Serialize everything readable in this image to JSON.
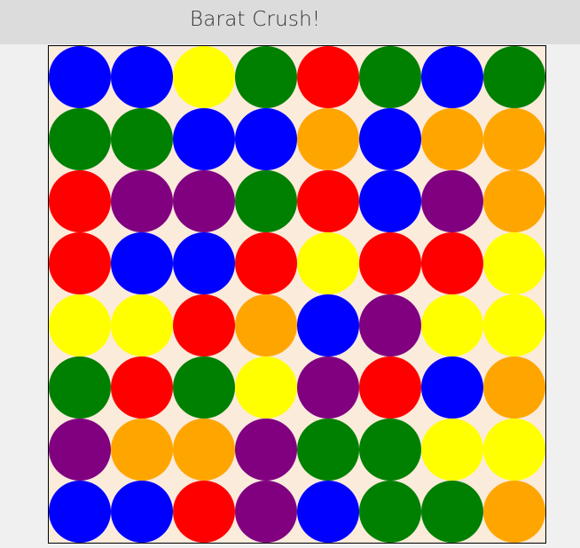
{
  "header": {
    "title": "Barat Crush!"
  },
  "colors": {
    "blue": "#0000ff",
    "yellow": "#ffff00",
    "green": "#008000",
    "red": "#ff0000",
    "orange": "#ffa500",
    "purple": "#800080",
    "board_background": "#fbebdb",
    "header_background": "#dcdcdc",
    "page_background": "#f0f0f0"
  },
  "board": {
    "rows": 8,
    "cols": 8,
    "grid": [
      [
        "blue",
        "blue",
        "yellow",
        "green",
        "red",
        "green",
        "blue",
        "green"
      ],
      [
        "green",
        "green",
        "blue",
        "blue",
        "orange",
        "blue",
        "orange",
        "orange"
      ],
      [
        "red",
        "purple",
        "purple",
        "green",
        "red",
        "blue",
        "purple",
        "orange"
      ],
      [
        "red",
        "blue",
        "blue",
        "red",
        "yellow",
        "red",
        "red",
        "yellow"
      ],
      [
        "yellow",
        "yellow",
        "red",
        "orange",
        "blue",
        "purple",
        "yellow",
        "yellow"
      ],
      [
        "green",
        "red",
        "green",
        "yellow",
        "purple",
        "red",
        "blue",
        "orange"
      ],
      [
        "purple",
        "orange",
        "orange",
        "purple",
        "green",
        "green",
        "yellow",
        "yellow"
      ],
      [
        "blue",
        "blue",
        "red",
        "purple",
        "blue",
        "green",
        "green",
        "orange"
      ]
    ]
  }
}
